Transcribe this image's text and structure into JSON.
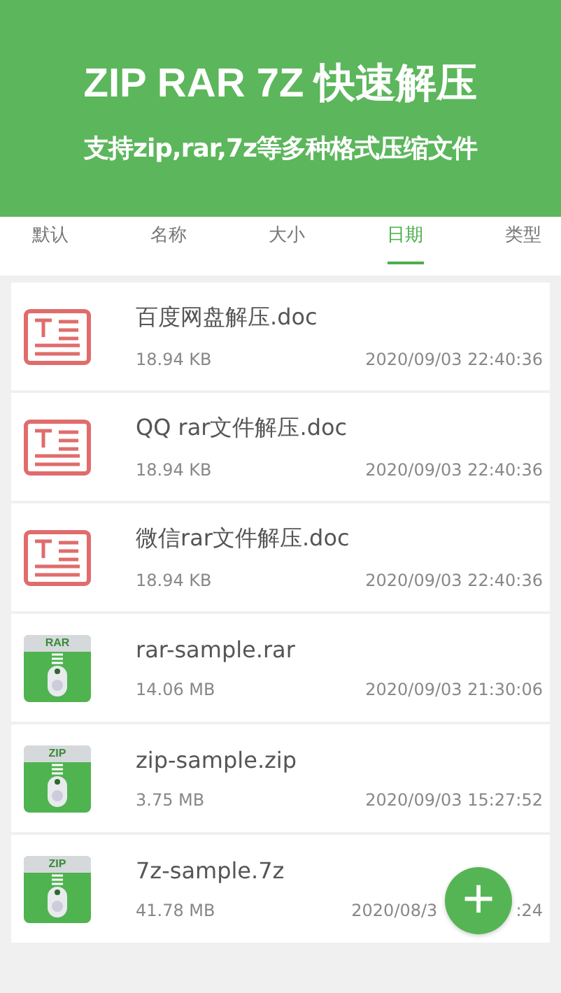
{
  "header": {
    "title": "ZIP RAR 7Z 快速解压",
    "subtitle": "支持zip,rar,7z等多种格式压缩文件"
  },
  "tabs": [
    {
      "label": "默认",
      "selected": false
    },
    {
      "label": "名称",
      "selected": false
    },
    {
      "label": "大小",
      "selected": false
    },
    {
      "label": "日期",
      "selected": true
    },
    {
      "label": "类型",
      "selected": false
    }
  ],
  "files": [
    {
      "kind": "doc",
      "name": "百度网盘解压.doc",
      "size": "18.94 KB",
      "date": "2020/09/03 22:40:36"
    },
    {
      "kind": "doc",
      "name": "QQ rar文件解压.doc",
      "size": "18.94 KB",
      "date": "2020/09/03 22:40:36"
    },
    {
      "kind": "doc",
      "name": "微信rar文件解压.doc",
      "size": "18.94 KB",
      "date": "2020/09/03 22:40:36"
    },
    {
      "kind": "archive",
      "badge": "RAR",
      "name": "rar-sample.rar",
      "size": "14.06 MB",
      "date": "2020/09/03 21:30:06"
    },
    {
      "kind": "archive",
      "badge": "ZIP",
      "name": "zip-sample.zip",
      "size": "3.75 MB",
      "date": "2020/09/03 15:27:52"
    },
    {
      "kind": "archive",
      "badge": "ZIP",
      "name": "7z-sample.7z",
      "size": "41.78 MB",
      "date_visible_parts": [
        "2020/08/3",
        ":24"
      ]
    }
  ],
  "fab": {
    "label": "+"
  }
}
